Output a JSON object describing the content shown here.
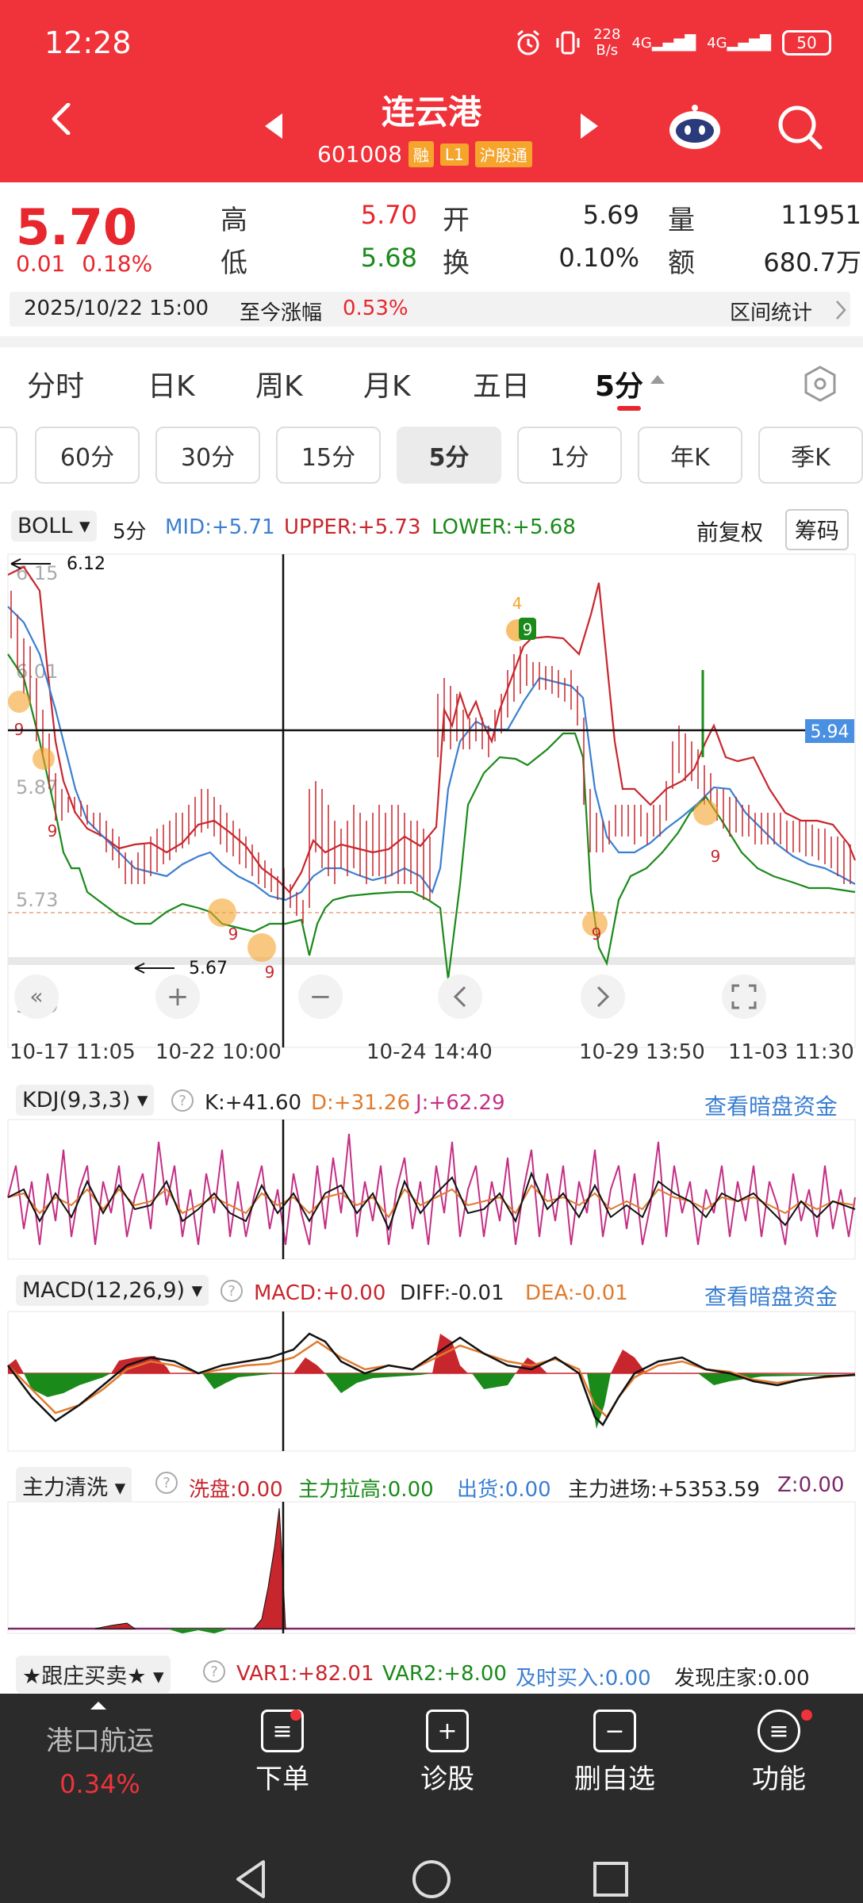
{
  "status": {
    "time": "12:28",
    "net_speed_top": "228",
    "net_speed_bottom": "B/s",
    "sig1": "4G",
    "sig2": "4G",
    "battery": "50"
  },
  "nav": {
    "title": "连云港",
    "code": "601008",
    "badges": [
      "融",
      "L1",
      "沪股通"
    ]
  },
  "quote": {
    "price": "5.70",
    "change": "0.01",
    "change_pct": "0.18%",
    "high_label": "高",
    "high": "5.70",
    "open_label": "开",
    "open": "5.69",
    "volume_label": "量",
    "volume": "11951",
    "low_label": "低",
    "low": "5.68",
    "turnover_label": "换",
    "turnover": "0.10%",
    "amount_label": "额",
    "amount": "680.7万",
    "date": "2025/10/22 15:00",
    "since_label": "至今涨幅",
    "since_value": "0.53%",
    "range_stats": "区间统计"
  },
  "period_tabs": [
    "分时",
    "日K",
    "周K",
    "月K",
    "五日",
    "5分"
  ],
  "sub_tabs": [
    "60分",
    "30分",
    "15分",
    "5分",
    "1分",
    "年K",
    "季K"
  ],
  "boll": {
    "selector": "BOLL",
    "period": "5分",
    "mid": "MID:+5.71",
    "upper": "UPPER:+5.73",
    "lower": "LOWER:+5.68",
    "adjust": "前复权",
    "chips": "筹码"
  },
  "main_chart": {
    "price_labels": [
      "6.15",
      "6.01",
      "5.87",
      "5.73",
      "5.59"
    ],
    "max_marker": "6.12",
    "min_marker": "5.67",
    "crosshair_price": "5.94",
    "x_labels": [
      "10-17 11:05",
      "10-22 10:00",
      "10-24 14:40",
      "10-29 13:50",
      "11-03 11:30"
    ],
    "signal_marks": [
      "9",
      "9",
      "9",
      "9",
      "9",
      "9",
      "4",
      "9"
    ]
  },
  "kdj": {
    "selector": "KDJ(9,3,3)",
    "k": "K:+41.60",
    "d": "D:+31.26",
    "j": "J:+62.29",
    "link": "查看暗盘资金"
  },
  "macd": {
    "selector": "MACD(12,26,9)",
    "macd": "MACD:+0.00",
    "diff": "DIFF:-0.01",
    "dea": "DEA:-0.01",
    "link": "查看暗盘资金"
  },
  "clean": {
    "selector": "主力清洗",
    "wash": "洗盘:0.00",
    "lift": "主力拉高:0.00",
    "out": "出货:0.00",
    "inflow": "主力进场:+5353.59",
    "z": "Z:0.00"
  },
  "follow": {
    "selector": "★跟庄买卖★",
    "var1": "VAR1:+82.01",
    "var2": "VAR2:+8.00",
    "buy": "及时买入:0.00",
    "found": "发现庄家:0.00"
  },
  "bottom": {
    "sector": "港口航运",
    "sector_pct": "0.34%",
    "order": "下单",
    "diagnose": "诊股",
    "remove": "删自选",
    "func": "功能"
  },
  "colors": {
    "brand_red": "#f0323a",
    "up_red": "#e8262d",
    "down_green": "#1a8a1a",
    "mid_blue": "#3b7fd1"
  }
}
